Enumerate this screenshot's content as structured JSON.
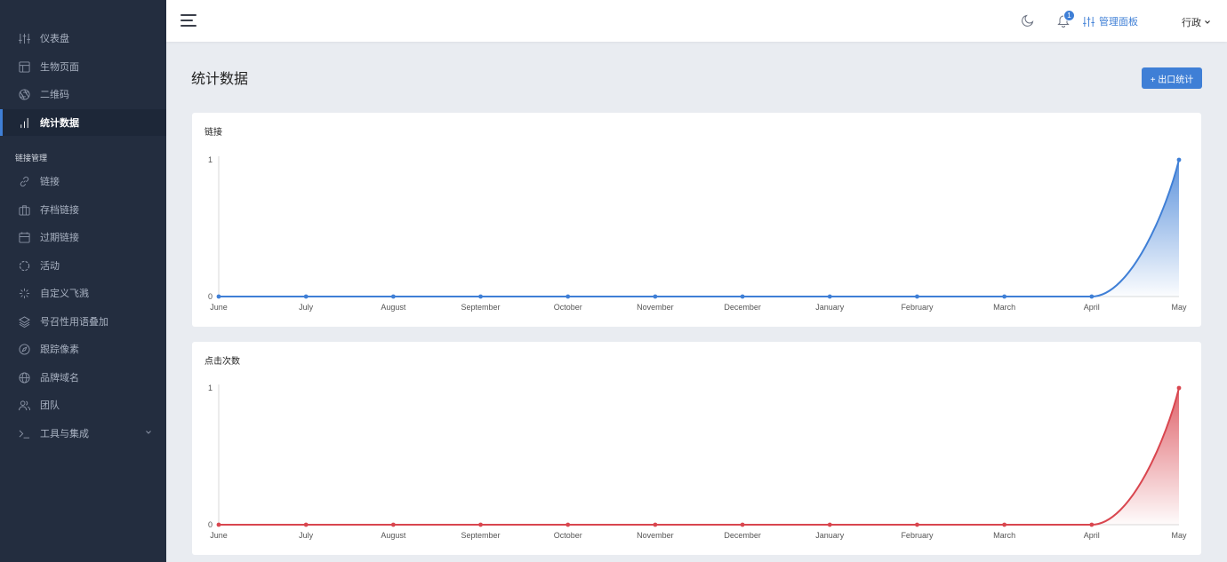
{
  "sidebar": {
    "items": [
      {
        "label": "仪表盘",
        "icon": "sliders-icon",
        "top": 28
      },
      {
        "label": "生物页面",
        "icon": "layout-icon",
        "top": 60
      },
      {
        "label": "二维码",
        "icon": "aperture-icon",
        "top": 91
      },
      {
        "label": "统计数据",
        "icon": "bar-chart-icon",
        "top": 123,
        "active": true
      }
    ],
    "section_label": "链接管理",
    "section_items": [
      {
        "label": "链接",
        "icon": "link-icon"
      },
      {
        "label": "存档链接",
        "icon": "briefcase-icon"
      },
      {
        "label": "过期链接",
        "icon": "calendar-icon"
      },
      {
        "label": "活动",
        "icon": "circle-dashed-icon"
      },
      {
        "label": "自定义飞溅",
        "icon": "loader-icon"
      },
      {
        "label": "号召性用语叠加",
        "icon": "layers-icon"
      },
      {
        "label": "跟踪像素",
        "icon": "compass-icon"
      },
      {
        "label": "品牌域名",
        "icon": "globe-icon"
      },
      {
        "label": "团队",
        "icon": "users-icon"
      },
      {
        "label": "工具与集成",
        "icon": "terminal-icon",
        "has_chevron": true
      }
    ]
  },
  "topbar": {
    "notification_count": "1",
    "admin_label": "管理面板",
    "user_label": "行政"
  },
  "main": {
    "title": "统计数据",
    "export_label": "+ 出口统计"
  },
  "colors": {
    "accent": "#3f7fd6",
    "links_series": "#3f7fd6",
    "clicks_series": "#d9464f"
  },
  "chart_data": [
    {
      "type": "area",
      "title": "链接",
      "categories": [
        "June",
        "July",
        "August",
        "September",
        "October",
        "November",
        "December",
        "January",
        "February",
        "March",
        "April",
        "May"
      ],
      "yticks": [
        "0",
        "1"
      ],
      "ylim": [
        0,
        1
      ],
      "series": [
        {
          "values": [
            0,
            0,
            0,
            0,
            0,
            0,
            0,
            0,
            0,
            0,
            0,
            1
          ],
          "color": "#3f7fd6"
        }
      ]
    },
    {
      "type": "area",
      "title": "点击次数",
      "categories": [
        "June",
        "July",
        "August",
        "September",
        "October",
        "November",
        "December",
        "January",
        "February",
        "March",
        "April",
        "May"
      ],
      "yticks": [
        "0",
        "1"
      ],
      "ylim": [
        0,
        1
      ],
      "series": [
        {
          "values": [
            0,
            0,
            0,
            0,
            0,
            0,
            0,
            0,
            0,
            0,
            0,
            1
          ],
          "color": "#d9464f"
        }
      ]
    }
  ]
}
